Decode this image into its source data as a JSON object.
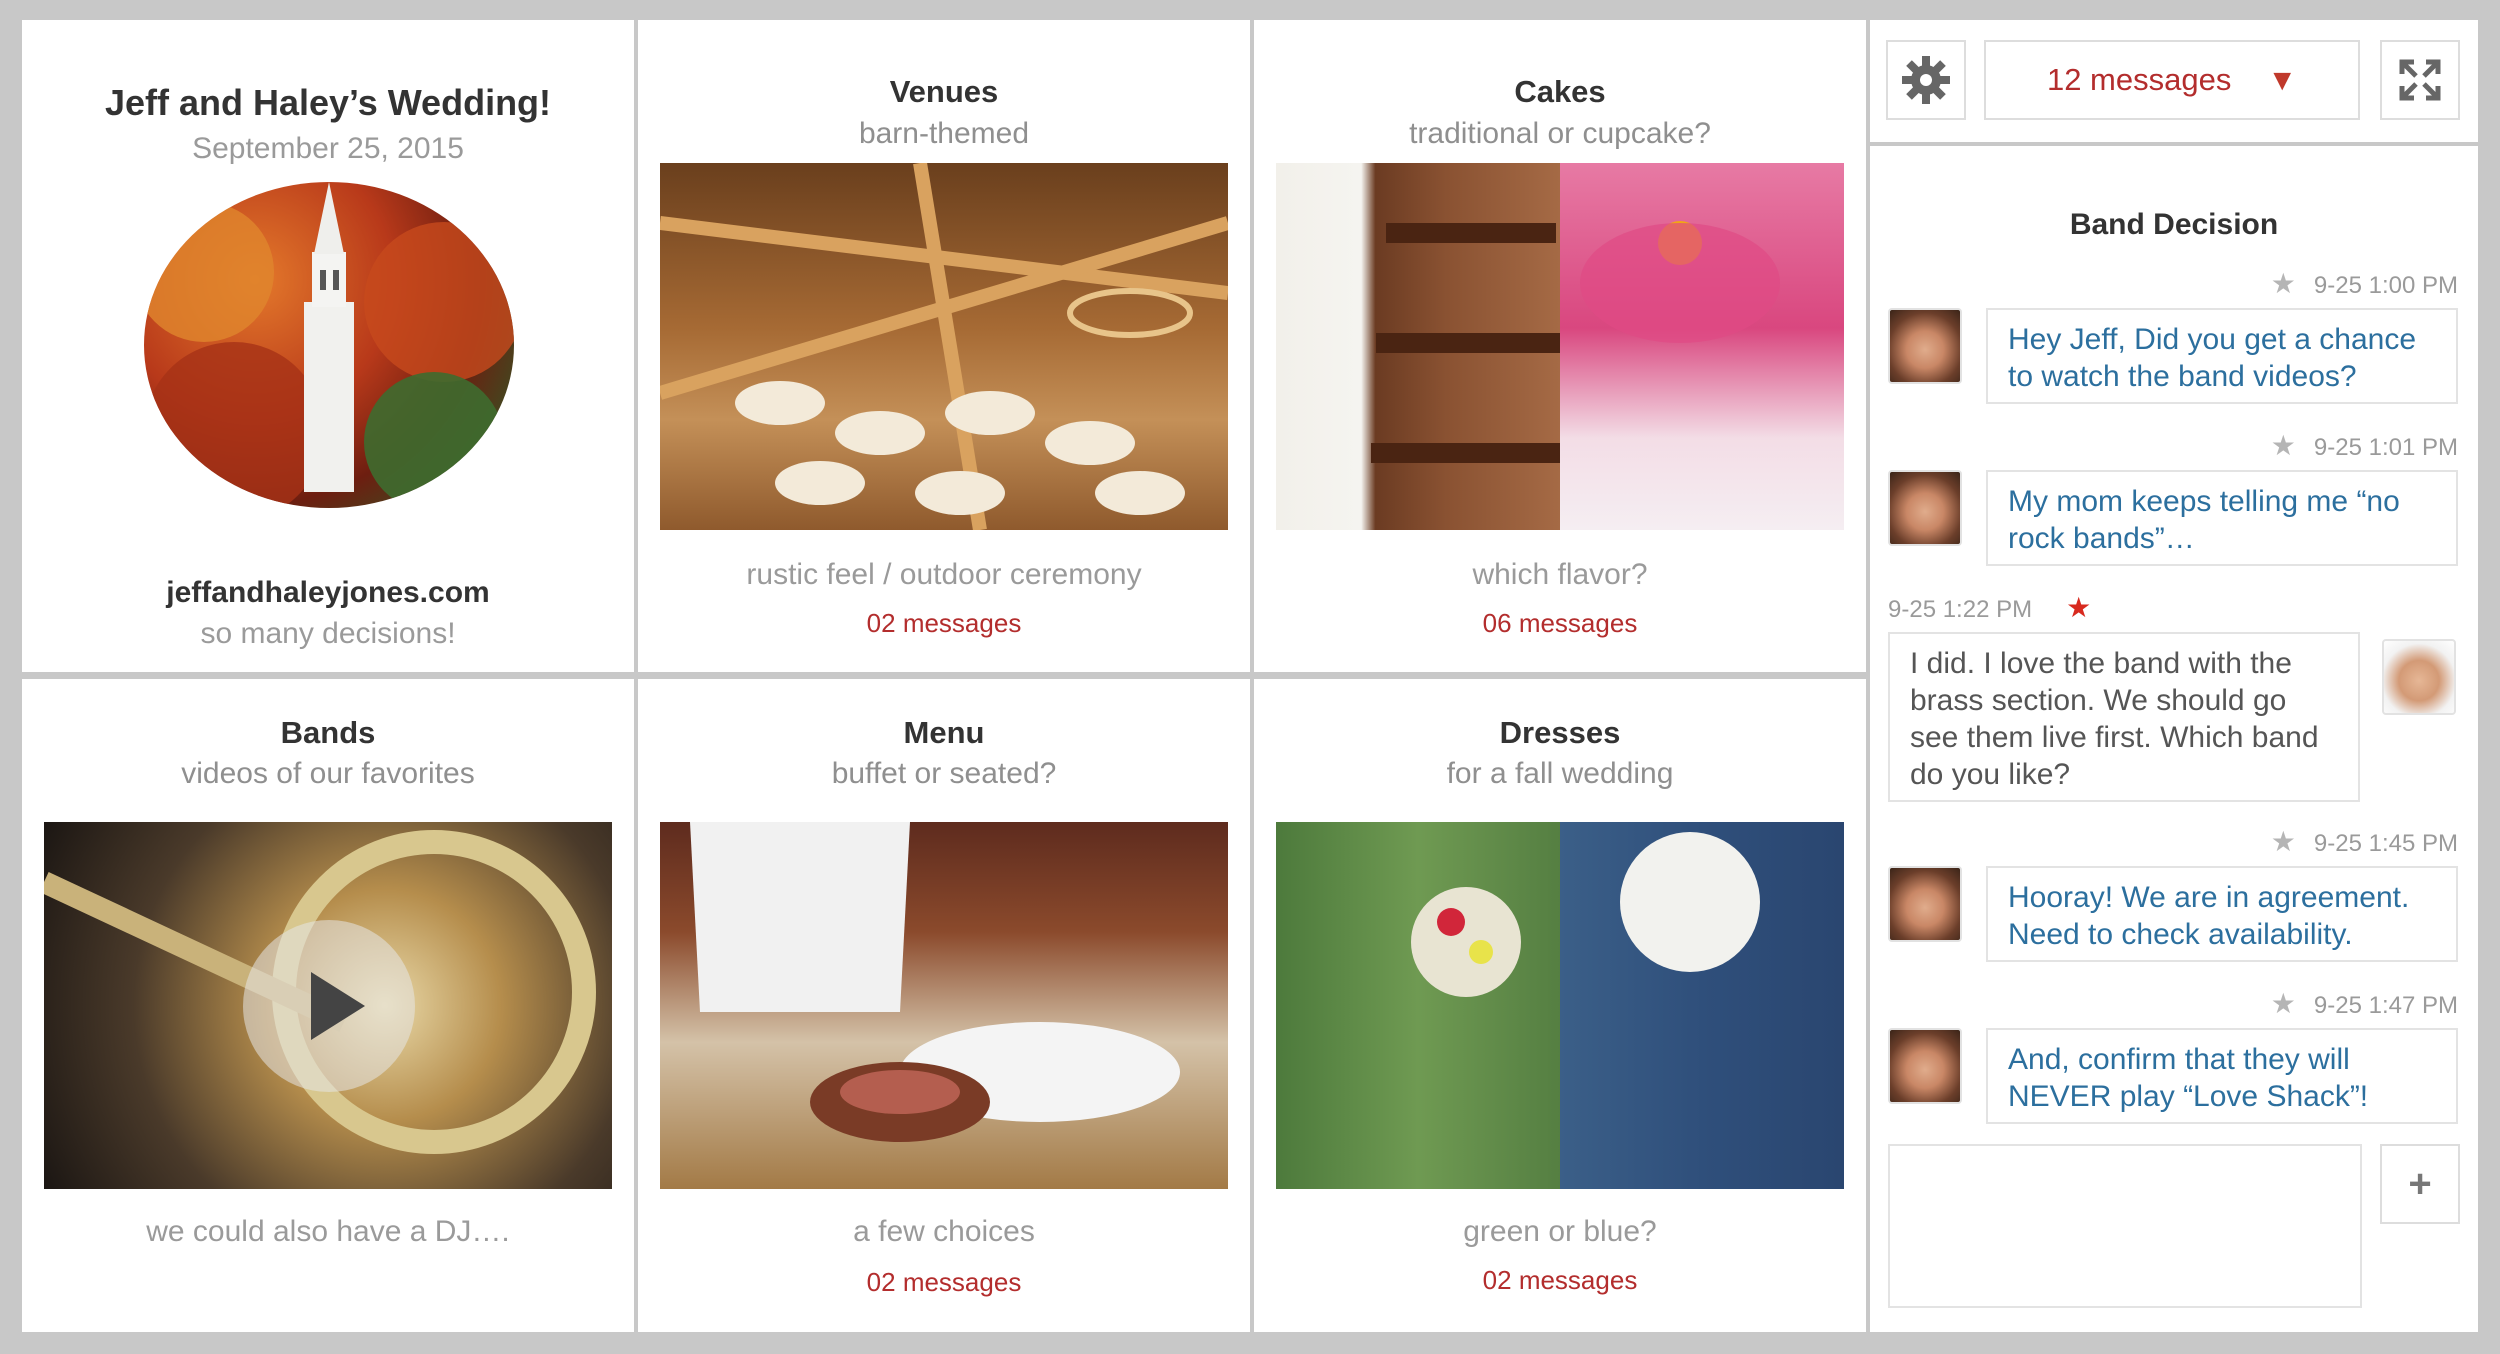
{
  "header": {
    "title": "Jeff and Haley’s Wedding!",
    "date": "September 25, 2015",
    "site": "jeffandhaleyjones.com",
    "tagline": "so many decisions!"
  },
  "tiles": {
    "venues": {
      "title": "Venues",
      "subtitle": "barn-themed",
      "caption": "rustic feel / outdoor ceremony",
      "messages": "02 messages"
    },
    "cakes": {
      "title": "Cakes",
      "subtitle": "traditional or cupcake?",
      "caption": "which flavor?",
      "messages": "06 messages"
    },
    "bands": {
      "title": "Bands",
      "subtitle": "videos of our favorites",
      "caption": "we could also have a DJ…."
    },
    "menu": {
      "title": "Menu",
      "subtitle": "buffet or seated?",
      "caption": "a few choices",
      "messages": "02 messages"
    },
    "dresses": {
      "title": "Dresses",
      "subtitle": "for a fall wedding",
      "caption": "green or blue?",
      "messages": "02 messages"
    }
  },
  "chat": {
    "count_label": "12 messages",
    "arrow": "▼",
    "title": "Band Decision",
    "messages": [
      {
        "time": "9-25   1:00 PM",
        "text_lines": [
          "Hey Jeff, Did you get a chance",
          "to watch the band videos?"
        ]
      },
      {
        "time": "9-25   1:01 PM",
        "text_lines": [
          "My mom keeps telling me “no",
          "rock bands”…"
        ]
      },
      {
        "time": "9-25   1:22 PM",
        "text_lines": [
          "I did.  I love the band with the",
          "brass section.  We should go",
          "see them live first.  Which band",
          "do you like?"
        ]
      },
      {
        "time": "9-25   1:45 PM",
        "text_lines": [
          "Hooray!  We are in agreement.",
          "Need to check availability."
        ]
      },
      {
        "time": "9-25   1:47 PM",
        "text_lines": [
          "And, confirm that they will",
          "NEVER play “Love Shack”!"
        ]
      }
    ],
    "add_label": "+"
  },
  "colors": {
    "accent_red": "#b32d2d",
    "link_blue": "#2c6f9e",
    "frame_gray": "#c8c8c8"
  }
}
